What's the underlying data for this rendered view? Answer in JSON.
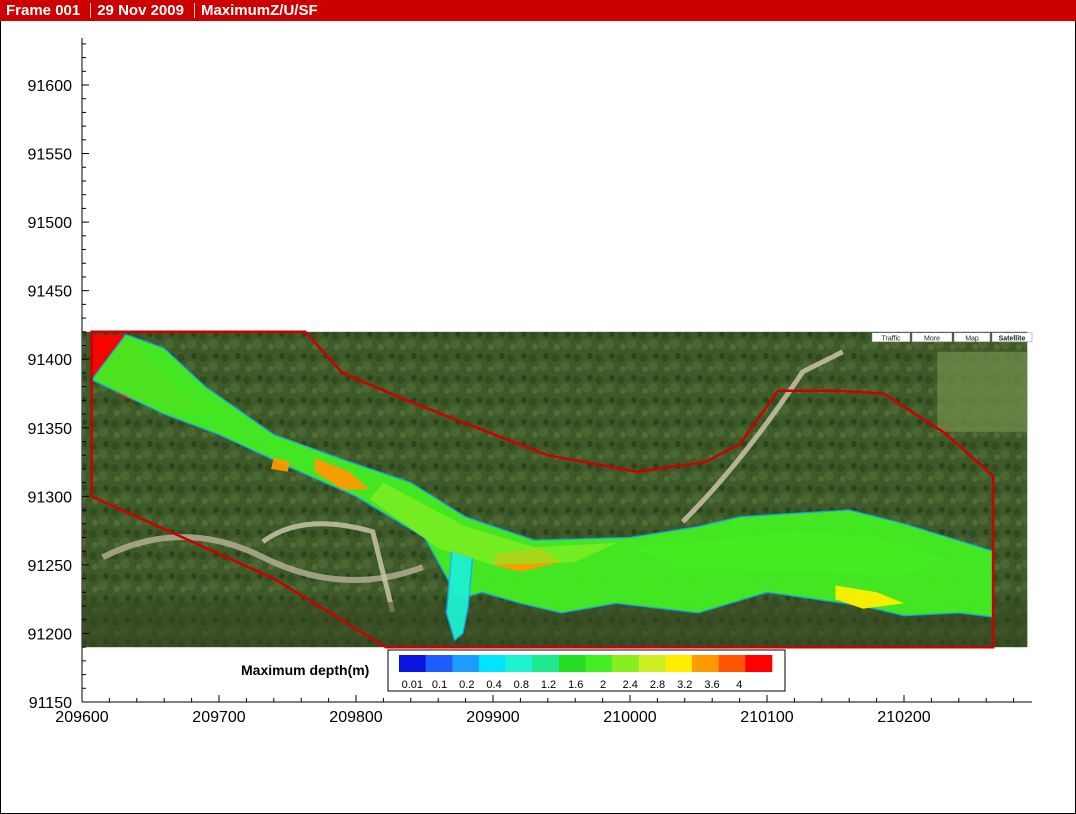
{
  "header": {
    "frame": "Frame 001",
    "date": "29 Nov 2009",
    "variable": "MaximumZ/U/SF"
  },
  "colors": {
    "title_bar": "#cc0000",
    "boundary": "#cc0000",
    "background": "#ffffff"
  },
  "chart_data": {
    "type": "heatmap",
    "title": "",
    "xlabel": "",
    "ylabel": "",
    "xlim": [
      209600,
      210290
    ],
    "ylim": [
      91150,
      91635
    ],
    "xticks": [
      209600,
      209700,
      209800,
      209900,
      210000,
      210100,
      210200
    ],
    "yticks": [
      91150,
      91200,
      91250,
      91300,
      91350,
      91400,
      91450,
      91500,
      91550,
      91600
    ],
    "background_image": "aerial satellite photo",
    "image_extent": {
      "x": [
        209602,
        210290
      ],
      "y": [
        91190,
        91420
      ]
    },
    "map_controls": [
      "Traffic",
      "More",
      "Map",
      "Satellite"
    ],
    "legend": {
      "title": "Maximum depth(m)",
      "placement": "bottom-center",
      "labels": [
        "0.01",
        "0.1",
        "0.2",
        "0.4",
        "0.8",
        "1.2",
        "1.6",
        "2",
        "2.4",
        "2.8",
        "3.2",
        "3.6",
        "4"
      ],
      "colors": [
        "#0a14e0",
        "#1f5cff",
        "#1e9cff",
        "#00e4ff",
        "#1ef0d0",
        "#1ee890",
        "#22dd22",
        "#44ee22",
        "#88ee22",
        "#ccee22",
        "#ffee00",
        "#ff9900",
        "#ff5500",
        "#ff0000"
      ]
    },
    "boundary_polygon": [
      [
        209607,
        91420
      ],
      [
        209763,
        91420
      ],
      [
        209790,
        91390
      ],
      [
        209830,
        91373
      ],
      [
        209875,
        91355
      ],
      [
        209940,
        91330
      ],
      [
        210005,
        91318
      ],
      [
        210055,
        91325
      ],
      [
        210080,
        91338
      ],
      [
        210108,
        91377
      ],
      [
        210150,
        91377
      ],
      [
        210185,
        91375
      ],
      [
        210230,
        91346
      ],
      [
        210265,
        91315
      ],
      [
        210265,
        91190
      ],
      [
        210045,
        91190
      ],
      [
        209900,
        91190
      ],
      [
        209822,
        91190
      ],
      [
        209740,
        91240
      ],
      [
        209607,
        91300
      ]
    ],
    "depth_regions": [
      {
        "depth": 4.0,
        "points": [
          [
            209607,
            91418
          ],
          [
            209632,
            91418
          ],
          [
            209668,
            91380
          ],
          [
            209690,
            91362
          ],
          [
            209668,
            91362
          ],
          [
            209630,
            91372
          ],
          [
            209607,
            91390
          ]
        ]
      },
      {
        "depth": 1.6,
        "points": [
          [
            209632,
            91418
          ],
          [
            209660,
            91408
          ],
          [
            209690,
            91380
          ],
          [
            209740,
            91345
          ],
          [
            209790,
            91327
          ],
          [
            209840,
            91310
          ],
          [
            209880,
            91285
          ],
          [
            209930,
            91268
          ],
          [
            210000,
            91270
          ],
          [
            210050,
            91278
          ],
          [
            210080,
            91285
          ],
          [
            210110,
            91287
          ],
          [
            210160,
            91290
          ],
          [
            210200,
            91280
          ],
          [
            210265,
            91260
          ],
          [
            210265,
            91212
          ],
          [
            210240,
            91215
          ],
          [
            210200,
            91213
          ],
          [
            210170,
            91220
          ],
          [
            210100,
            91230
          ],
          [
            210050,
            91215
          ],
          [
            209990,
            91222
          ],
          [
            209950,
            91215
          ],
          [
            209920,
            91222
          ],
          [
            209892,
            91230
          ],
          [
            209875,
            91225
          ],
          [
            209850,
            91270
          ],
          [
            209800,
            91300
          ],
          [
            209750,
            91322
          ],
          [
            209700,
            91345
          ],
          [
            209660,
            91360
          ],
          [
            209607,
            91385
          ]
        ]
      },
      {
        "depth": 0.4,
        "points": [
          [
            209870,
            91260
          ],
          [
            209885,
            91255
          ],
          [
            209882,
            91220
          ],
          [
            209878,
            91200
          ],
          [
            209872,
            91195
          ],
          [
            209866,
            91215
          ]
        ]
      },
      {
        "depth": 3.2,
        "points": [
          [
            209770,
            91328
          ],
          [
            209795,
            91318
          ],
          [
            209810,
            91305
          ],
          [
            209790,
            91305
          ],
          [
            209770,
            91318
          ]
        ]
      },
      {
        "depth": 3.2,
        "points": [
          [
            209902,
            91258
          ],
          [
            209935,
            91262
          ],
          [
            209950,
            91252
          ],
          [
            209920,
            91245
          ],
          [
            209900,
            91250
          ]
        ]
      },
      {
        "depth": 3.2,
        "points": [
          [
            209740,
            91328
          ],
          [
            209752,
            91325
          ],
          [
            209750,
            91318
          ],
          [
            209738,
            91320
          ]
        ]
      },
      {
        "depth": 2.8,
        "points": [
          [
            210150,
            91235
          ],
          [
            210180,
            91230
          ],
          [
            210200,
            91222
          ],
          [
            210170,
            91218
          ],
          [
            210150,
            91225
          ]
        ]
      }
    ]
  }
}
